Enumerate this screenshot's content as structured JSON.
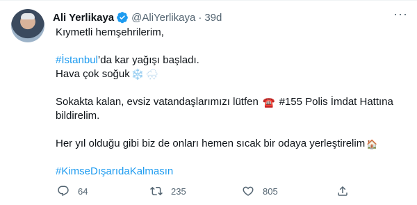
{
  "author": {
    "name": "Ali Yerlikaya",
    "handle": "@AliYerlikaya",
    "separator": "·",
    "time": "39d"
  },
  "tweet": {
    "line1": "Kıymetli hemşehrilerim,",
    "line2_tag": "#İstanbul",
    "line2_text": "’da kar yağışı başladı.",
    "line3_text": "Hava çok soğuk",
    "line3_emoji_1": "❄️",
    "line3_emoji_2": "🌨",
    "line4_text_a": "Sokakta kalan, evsiz vatandaşlarımızı lütfen",
    "line4_emoji": "☎️",
    "line4_text_b": "#155 Polis İmdat Hattına",
    "line5_text": "bildirelim.",
    "line6_text": "Her yıl olduğu gibi biz de onları hemen sıcak bir odaya yerleştirelim",
    "line6_emoji": "🏠",
    "line7_tag": "#KimseDışarıdaKalmasın"
  },
  "actions": {
    "reply_count": "64",
    "retweet_count": "235",
    "like_count": "805"
  },
  "colors": {
    "link": "#1d9bf0",
    "muted": "#536471",
    "verified": "#1d9bf0"
  }
}
